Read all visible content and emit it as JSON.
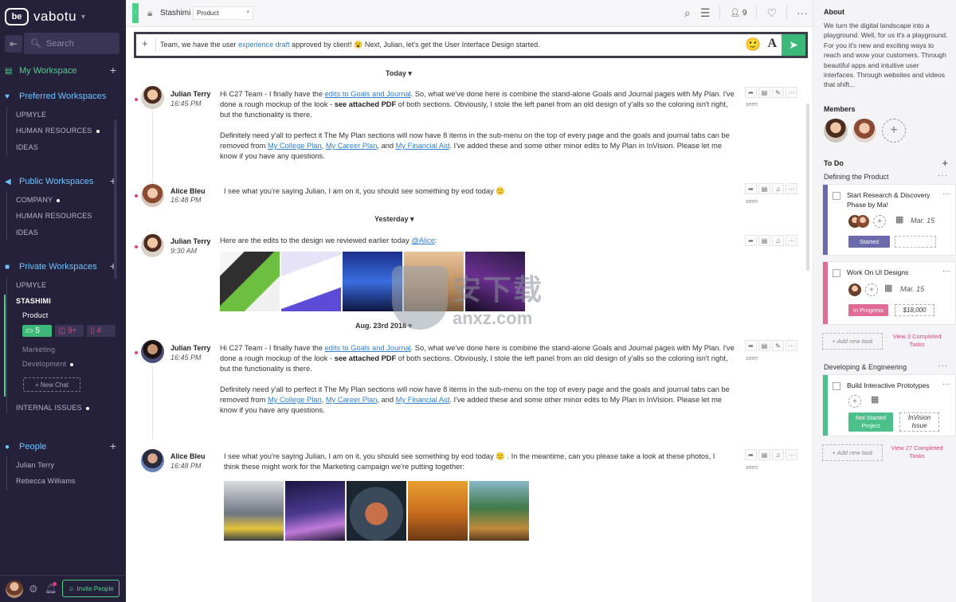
{
  "brand": {
    "logo": "be",
    "name": "vabotu"
  },
  "sidebar": {
    "search_placeholder": "Search",
    "my_workspace": "My Workspace",
    "preferred": {
      "label": "Preferred Workspaces",
      "items": [
        "UPMYLE",
        "HUMAN RESOURCES",
        "IDEAS"
      ]
    },
    "public": {
      "label": "Public Workspaces",
      "items": [
        "COMPANY",
        "HUMAN RESOURCES",
        "IDEAS"
      ]
    },
    "private": {
      "label": "Private Workspaces",
      "items": [
        "UPMYLE",
        "STASHIMI"
      ],
      "stashimi_channels": [
        "Product",
        "Marketing",
        "Development"
      ],
      "badges": {
        "chat": "5",
        "tasks": "9+",
        "files": "4"
      },
      "new_chat": "+ New Chat",
      "internal": "INTERNAL ISSUES"
    },
    "people": {
      "label": "People",
      "items": [
        "Julian Terry",
        "Rebecca Williams"
      ]
    },
    "invite": "Invite People"
  },
  "topbar": {
    "workspace": "Stashimi",
    "channel": "Product",
    "members_count": "9"
  },
  "composer": {
    "text_before": "Team, we have the user ",
    "link": "experience draft",
    "text_after": " approved by client! 😮 Next, Julian, let's get the User Interface Design started.",
    "font_button": "A"
  },
  "dates": {
    "today": "Today ▾",
    "yesterday": "Yesterday ▾",
    "aug": "Aug. 23rd 2018 ▾"
  },
  "messages": [
    {
      "name": "Julian Terry",
      "time": "16:45 PM",
      "p1_a": "Hi C27 Team - I finally have the ",
      "p1_link": "edits to Goals and Journal",
      "p1_b": ". So, what we've done here is combine the stand-alone Goals and Journal pages with My Plan. I've done a rough mockup of the look - ",
      "p1_bold": "see attached PDF",
      "p1_c": " of both sections. Obviously, I stole the left panel from an old design of y'alls so the coloring isn't right, but the functionality is there.",
      "p2_a": "Definitely need y'all to perfect it  The My Plan sections will now have 8 items in the sub-menu on the top of every page and the goals and journal tabs can be removed from ",
      "p2_l1": "My College Plan",
      "p2_sep1": ", ",
      "p2_l2": "My Career Plan",
      "p2_sep2": ", and ",
      "p2_l3": "My Financial Aid",
      "p2_b": ". I've added these and some other minor edits to My Plan in InVision. Please let me know if you have any questions."
    },
    {
      "name": "Alice Bleu",
      "time": "16:48 PM",
      "text": "I see what you're saying Julian, I am on it, you should see something by eod today 🙂"
    },
    {
      "name": "Julian Terry",
      "time": "9:30 AM",
      "text": "Here are the edits to the design we reviewed earlier today ",
      "mention": "@Alice",
      "end": ":"
    },
    {
      "name": "Alice Bleu",
      "time": "16:48 PM",
      "text": "I see what you're saying Julian, I am on it, you should see something by eod today 🙂 . In the meantime, can you please take a look at these photos, I think these might work for the Marketing campaign we're putting together:"
    }
  ],
  "seen": "seen",
  "watermark": {
    "cn": "安下载",
    "en": "anxz.com"
  },
  "right": {
    "about_title": "About",
    "about_text": "We turn the digital landscape into a playground. Well, for us it's a playground. For you it's new and exciting ways to reach and wow your customers. Through beautiful apps and intuitive user interfaces. Through websites and videos that shift...",
    "members_title": "Members",
    "todo_title": "To Do",
    "group1": "Defining the Product",
    "group2": "Developing & Engineering",
    "tasks": [
      {
        "title": "Start Research &  Discovery Phase by Ma!",
        "date": "Mar. 15",
        "status": "Started",
        "color": "#6b6bab"
      },
      {
        "title": "Work On UI Designs",
        "date": "Mar. 15",
        "status": "In Progress",
        "amount": "$18,000",
        "color": "#e06b95"
      },
      {
        "title": "Build Interactive Prototypes",
        "status": "Not Started Project",
        "amount": "InVision Issue",
        "color": "#4cbf8a"
      }
    ],
    "add_task": "+ Add new task",
    "view1": "View 3 Completed Tasks",
    "view2": "View 27 Completed Tasks"
  }
}
